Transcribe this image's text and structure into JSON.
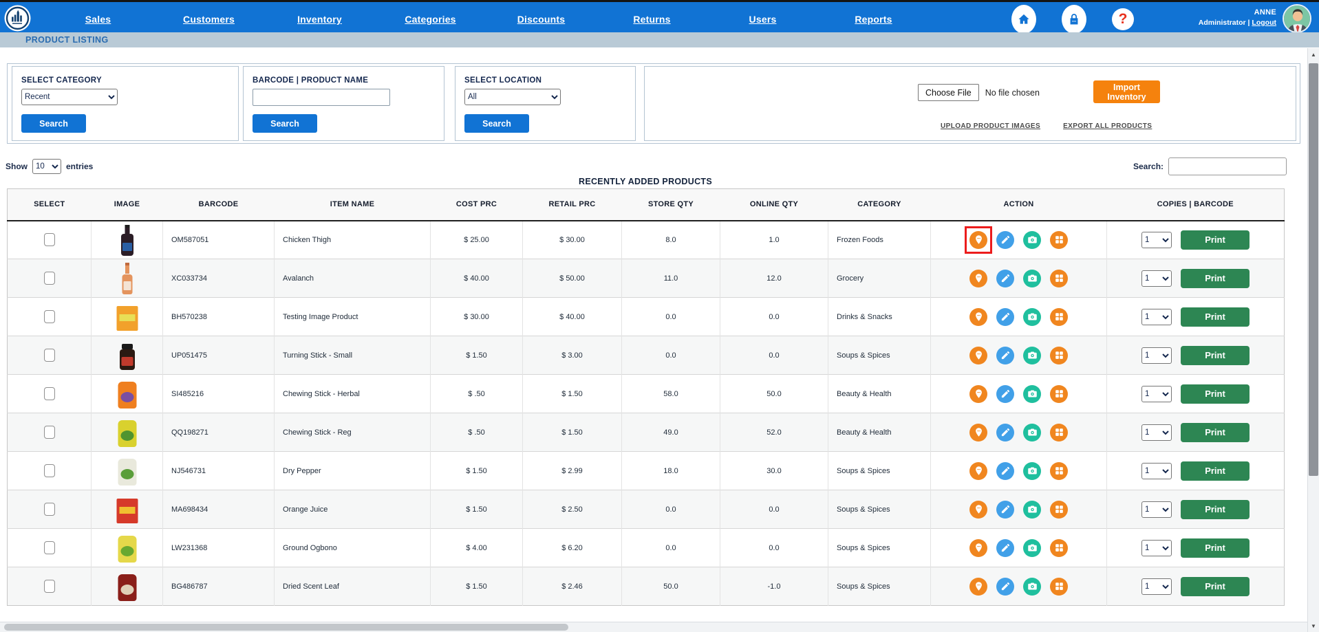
{
  "nav": {
    "items": [
      "Sales",
      "Customers",
      "Inventory",
      "Categories",
      "Discounts",
      "Returns",
      "Users",
      "Reports"
    ],
    "help_glyph": "?",
    "user": {
      "name": "ANNE",
      "role": "Administrator",
      "separator": "|",
      "logout_label": "Logout"
    }
  },
  "breadcrumb": "PRODUCT LISTING",
  "filters": {
    "category": {
      "label": "SELECT CATEGORY",
      "value": "Recent",
      "button": "Search"
    },
    "barcode": {
      "label": "BARCODE | PRODUCT NAME",
      "value": "",
      "button": "Search"
    },
    "location": {
      "label": "SELECT LOCATION",
      "value": "All",
      "button": "Search"
    },
    "import": {
      "choose_file_label": "Choose File",
      "file_status": "No file chosen",
      "button": "Import Inventory",
      "upload_link": "UPLOAD PRODUCT IMAGES",
      "export_link": "EXPORT ALL PRODUCTS"
    }
  },
  "table_controls": {
    "show_label": "Show",
    "entries_value": "10",
    "entries_label": "entries",
    "search_label": "Search:",
    "search_value": ""
  },
  "table": {
    "title": "RECENTLY ADDED PRODUCTS",
    "columns": [
      "SELECT",
      "IMAGE",
      "BARCODE",
      "ITEM NAME",
      "COST PRC",
      "RETAIL PRC",
      "STORE QTY",
      "ONLINE QTY",
      "CATEGORY",
      "ACTION",
      "COPIES | BARCODE"
    ],
    "print_label": "Print",
    "products": [
      {
        "barcode": "OM587051",
        "item_name": "Chicken Thigh",
        "cost": "$ 25.00",
        "retail": "$ 30.00",
        "store_qty": "8.0",
        "online_qty": "1.0",
        "category": "Frozen Foods",
        "copies": "1",
        "location_highlighted": true,
        "image": {
          "kind": "bottle",
          "colors": [
            "#2b1d26",
            "#2b5fa3"
          ]
        }
      },
      {
        "barcode": "XC033734",
        "item_name": "Avalanch",
        "cost": "$ 40.00",
        "retail": "$ 50.00",
        "store_qty": "11.0",
        "online_qty": "12.0",
        "category": "Grocery",
        "copies": "1",
        "location_highlighted": false,
        "image": {
          "kind": "wine",
          "colors": [
            "#e4945e",
            "#f4e3d4"
          ]
        }
      },
      {
        "barcode": "BH570238",
        "item_name": "Testing Image Product",
        "cost": "$ 30.00",
        "retail": "$ 40.00",
        "store_qty": "0.0",
        "online_qty": "0.0",
        "category": "Drinks & Snacks",
        "copies": "1",
        "location_highlighted": false,
        "image": {
          "kind": "box",
          "colors": [
            "#f2a12b",
            "#e8df56"
          ]
        }
      },
      {
        "barcode": "UP051475",
        "item_name": "Turning Stick - Small",
        "cost": "$ 1.50",
        "retail": "$ 3.00",
        "store_qty": "0.0",
        "online_qty": "0.0",
        "category": "Soups & Spices",
        "copies": "1",
        "location_highlighted": false,
        "image": {
          "kind": "jar",
          "colors": [
            "#2c1a12",
            "#c23a2c"
          ]
        }
      },
      {
        "barcode": "SI485216",
        "item_name": "Chewing Stick - Herbal",
        "cost": "$ .50",
        "retail": "$ 1.50",
        "store_qty": "58.0",
        "online_qty": "50.0",
        "category": "Beauty & Health",
        "copies": "1",
        "location_highlighted": false,
        "image": {
          "kind": "pouch",
          "colors": [
            "#ef7f1f",
            "#7a4fa2"
          ]
        }
      },
      {
        "barcode": "QQ198271",
        "item_name": "Chewing Stick - Reg",
        "cost": "$ .50",
        "retail": "$ 1.50",
        "store_qty": "49.0",
        "online_qty": "52.0",
        "category": "Beauty & Health",
        "copies": "1",
        "location_highlighted": false,
        "image": {
          "kind": "pouch",
          "colors": [
            "#d9d12e",
            "#4f9430"
          ]
        }
      },
      {
        "barcode": "NJ546731",
        "item_name": "Dry Pepper",
        "cost": "$ 1.50",
        "retail": "$ 2.99",
        "store_qty": "18.0",
        "online_qty": "30.0",
        "category": "Soups & Spices",
        "copies": "1",
        "location_highlighted": false,
        "image": {
          "kind": "pouch",
          "colors": [
            "#e9e9dc",
            "#5a9e3a"
          ]
        }
      },
      {
        "barcode": "MA698434",
        "item_name": "Orange Juice",
        "cost": "$ 1.50",
        "retail": "$ 2.50",
        "store_qty": "0.0",
        "online_qty": "0.0",
        "category": "Soups & Spices",
        "copies": "1",
        "location_highlighted": false,
        "image": {
          "kind": "box",
          "colors": [
            "#d63a2a",
            "#f0c030"
          ]
        }
      },
      {
        "barcode": "LW231368",
        "item_name": "Ground Ogbono",
        "cost": "$ 4.00",
        "retail": "$ 6.20",
        "store_qty": "0.0",
        "online_qty": "0.0",
        "category": "Soups & Spices",
        "copies": "1",
        "location_highlighted": false,
        "image": {
          "kind": "pouch",
          "colors": [
            "#e5d84a",
            "#68a830"
          ]
        }
      },
      {
        "barcode": "BG486787",
        "item_name": "Dried Scent Leaf",
        "cost": "$ 1.50",
        "retail": "$ 2.46",
        "store_qty": "50.0",
        "online_qty": "-1.0",
        "category": "Soups & Spices",
        "copies": "1",
        "location_highlighted": false,
        "image": {
          "kind": "pouch",
          "colors": [
            "#8a1f1a",
            "#e0d0b8"
          ]
        }
      }
    ]
  },
  "colors": {
    "nav_blue": "#1173D4",
    "breadcrumb_bg": "#B9CAD6",
    "button_blue": "#1173D4",
    "import_orange": "#F5820D",
    "print_green": "#2D8653",
    "icon_orange": "#F0861F",
    "icon_blue": "#41A0E8",
    "icon_teal": "#1FBF9E",
    "highlight_red": "#EC1C1C",
    "help_red": "#E8321E"
  }
}
